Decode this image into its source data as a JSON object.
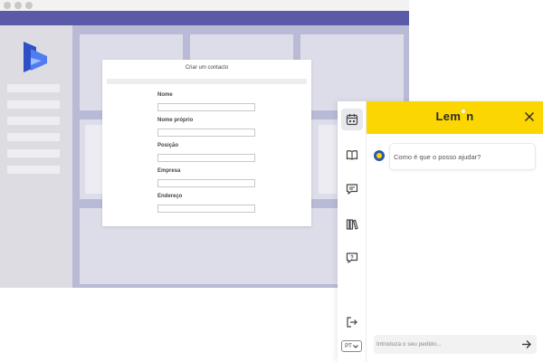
{
  "modal": {
    "title": "Criar um contacto",
    "fields": [
      {
        "label": "Nome",
        "value": ""
      },
      {
        "label": "Nome próprio",
        "value": ""
      },
      {
        "label": "Posição",
        "value": ""
      },
      {
        "label": "Empresa",
        "value": ""
      },
      {
        "label": "Endereço",
        "value": ""
      }
    ]
  },
  "panel": {
    "brand_left": "Lem",
    "brand_right": "n",
    "greeting": "Como é que o posso ajudar?",
    "input_placeholder": "Introduza o seu pedido...",
    "language": "PT",
    "rail_icons": [
      "calendar-icon",
      "book-icon",
      "chat-icon",
      "library-icon",
      "help-icon",
      "logout-icon"
    ]
  },
  "colors": {
    "brand_yellow": "#fcd600",
    "app_topbar": "#5b5aa8",
    "logo_blue": "#3b5bdb"
  }
}
